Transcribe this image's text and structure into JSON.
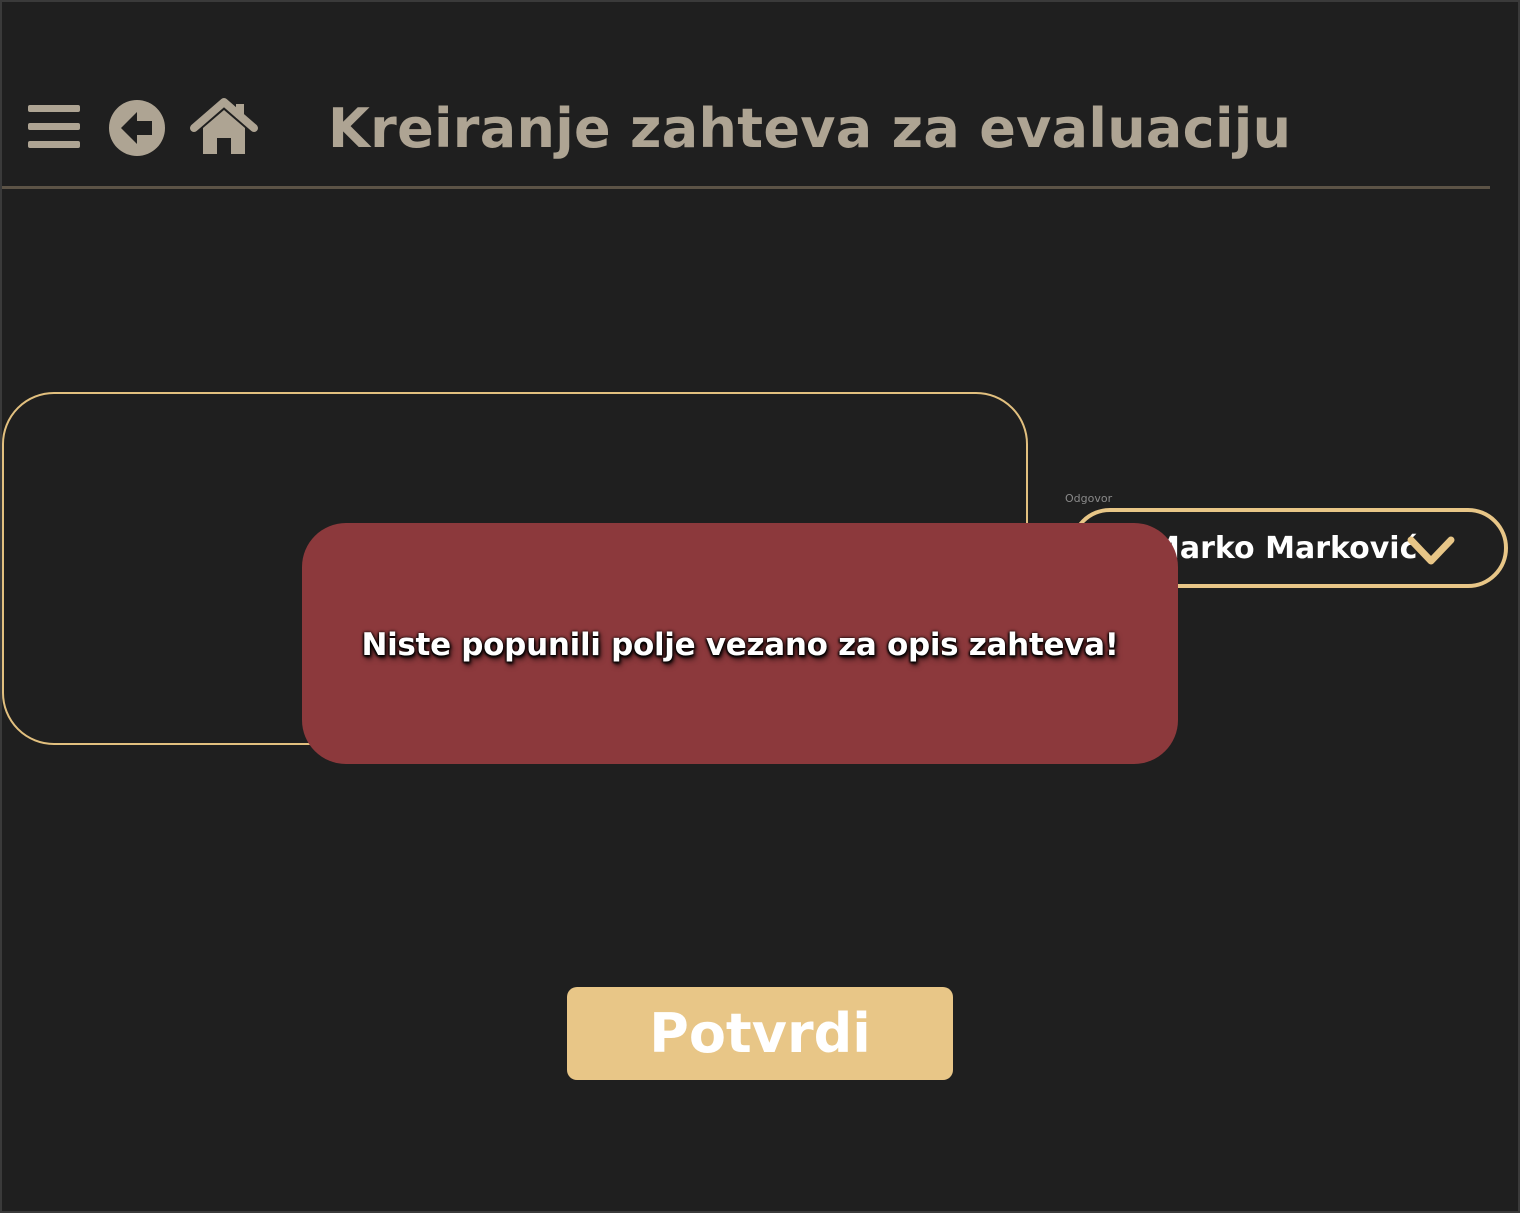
{
  "header": {
    "title": "Kreiranje zahteva za evaluaciju",
    "icons": [
      "menu-icon",
      "back-icon",
      "home-icon"
    ]
  },
  "form": {
    "description_value": "",
    "responder": {
      "label": "Odgovor",
      "selected_value": "Marko Marković",
      "icon": "chevron-down-icon"
    },
    "confirm_label": "Potvrdi"
  },
  "error": {
    "message": "Niste popunili polje vezano za opis zahteva!"
  },
  "colors": {
    "background": "#1f1f1f",
    "accent": "#e8c687",
    "title": "#aea493",
    "error_background": "#8c393c",
    "divider": "#5c5346"
  }
}
